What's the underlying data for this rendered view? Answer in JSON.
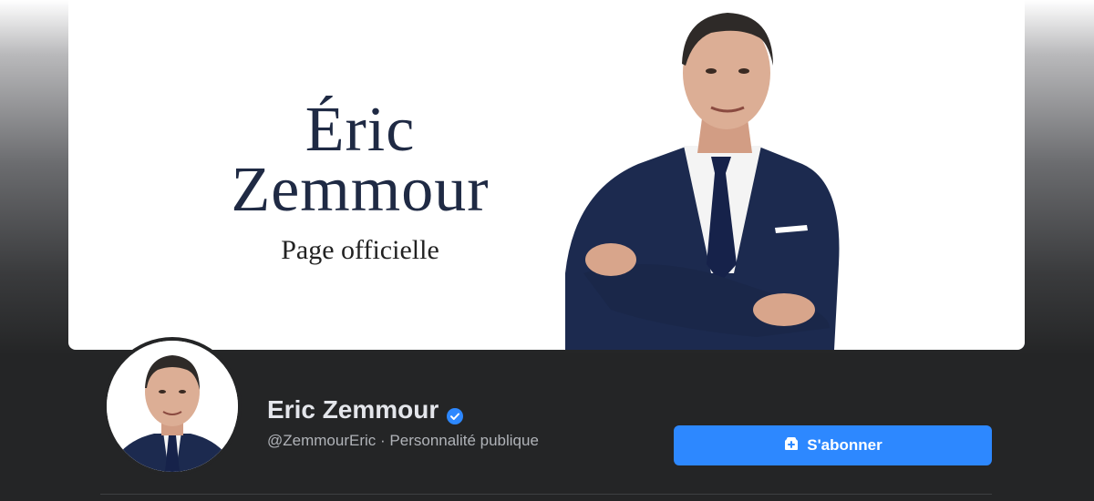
{
  "cover": {
    "first_name": "Éric",
    "last_name": "Zemmour",
    "subtitle": "Page officielle"
  },
  "profile": {
    "name": "Eric Zemmour",
    "handle": "@ZemmourEric",
    "separator": "·",
    "category": "Personnalité publique",
    "verified": true
  },
  "actions": {
    "subscribe_label": "S'abonner",
    "subscribe_icon": "subscribe-plus-icon"
  },
  "colors": {
    "accent": "#2d88ff",
    "background": "#242526",
    "name_text": "#e4e6eb",
    "secondary_text": "#b0b3b8",
    "suit": "#1c2a4f"
  }
}
